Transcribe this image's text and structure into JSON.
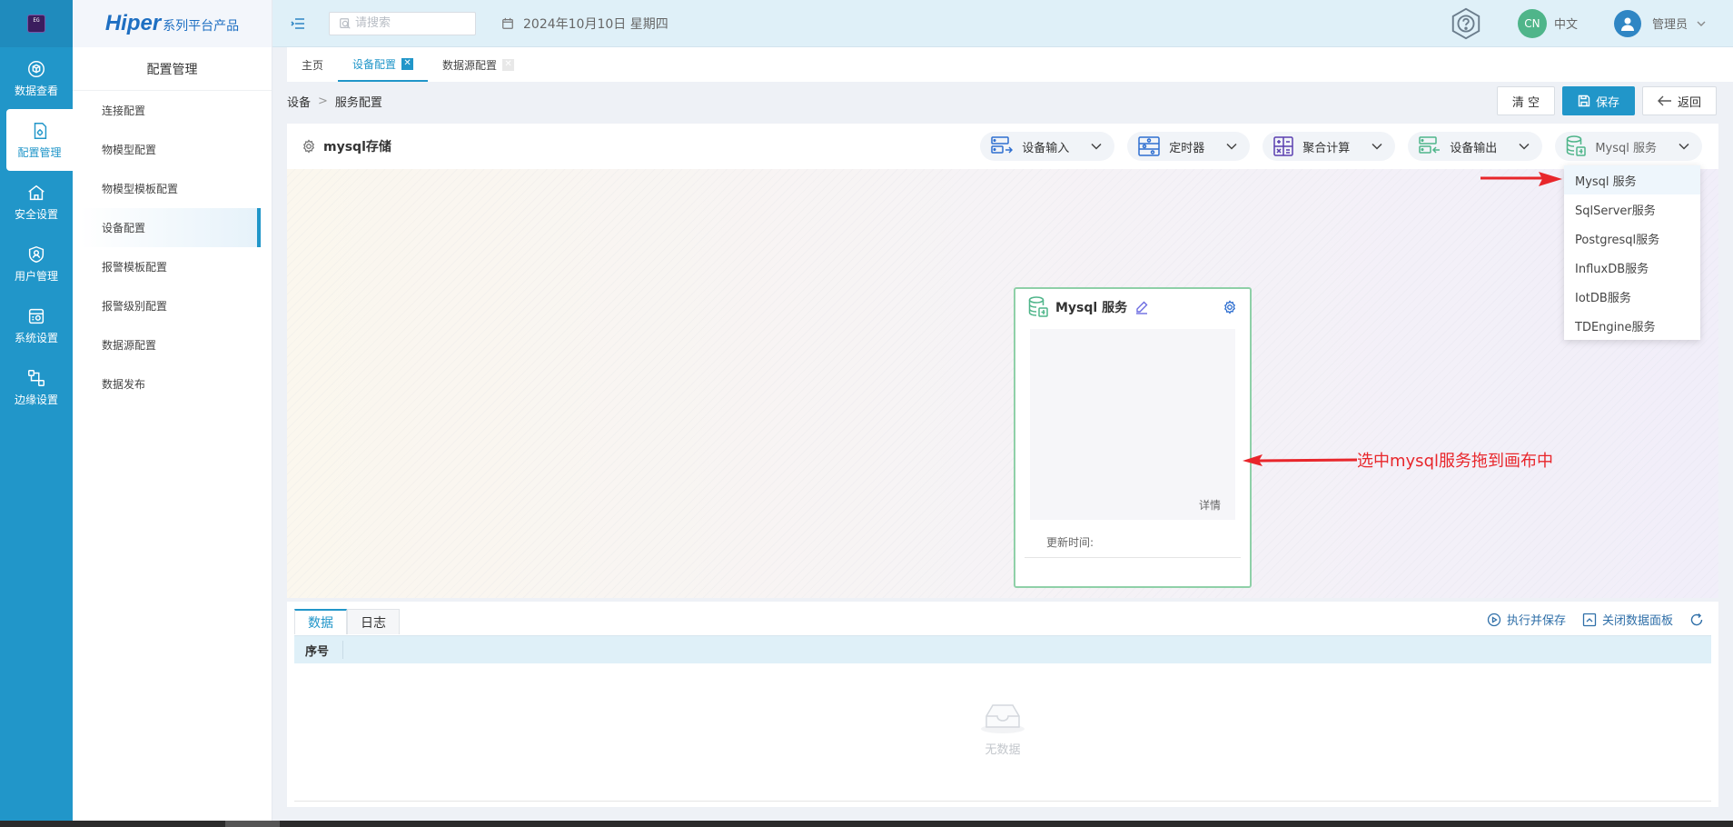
{
  "rail": {
    "items": [
      {
        "label": "数据查看",
        "icon": "cube-icon"
      },
      {
        "label": "配置管理",
        "icon": "config-doc-icon",
        "active": true
      },
      {
        "label": "安全设置",
        "icon": "home-shield-icon"
      },
      {
        "label": "用户管理",
        "icon": "user-shield-icon"
      },
      {
        "label": "系统设置",
        "icon": "system-settings-icon"
      },
      {
        "label": "边缘设置",
        "icon": "edge-network-icon"
      }
    ]
  },
  "brand": {
    "name": "Hiper",
    "suffix": "系列平台产品"
  },
  "sidebar": {
    "title": "配置管理",
    "items": [
      {
        "label": "连接配置"
      },
      {
        "label": "物模型配置"
      },
      {
        "label": "物模型模板配置"
      },
      {
        "label": "设备配置",
        "active": true
      },
      {
        "label": "报警模板配置"
      },
      {
        "label": "报警级别配置"
      },
      {
        "label": "数据源配置"
      },
      {
        "label": "数据发布"
      }
    ]
  },
  "header": {
    "search_placeholder": "请搜索",
    "date": "2024年10月10日 星期四",
    "lang_badge": "CN",
    "lang": "中文",
    "user": "管理员"
  },
  "tabs": [
    {
      "label": "主页"
    },
    {
      "label": "设备配置",
      "active": true
    },
    {
      "label": "数据源配置"
    }
  ],
  "breadcrumb": {
    "root": "设备",
    "sep": ">",
    "current": "服务配置"
  },
  "actions": {
    "clear": "清 空",
    "save": "保存",
    "back": "返回"
  },
  "toolbar": {
    "title": "mysql存储",
    "groups": [
      {
        "label": "设备输入"
      },
      {
        "label": "定时器"
      },
      {
        "label": "聚合计算"
      },
      {
        "label": "设备输出"
      },
      {
        "label": "Mysql 服务"
      }
    ]
  },
  "dropdown": {
    "items": [
      "Mysql 服务",
      "SqlServer服务",
      "Postgresql服务",
      "InfluxDB服务",
      "IotDB服务",
      "TDEngine服务"
    ]
  },
  "node": {
    "title": "Mysql 服务",
    "detail": "详情",
    "update_label": "更新时间:"
  },
  "annotation": "选中mysql服务拖到画布中",
  "panel": {
    "tabs": [
      {
        "label": "数据"
      },
      {
        "label": "日志"
      }
    ],
    "run_save": "执行并保存",
    "close_panel": "关闭数据面板",
    "column": "序号",
    "empty": "无数据"
  },
  "colors": {
    "primary": "#2196c9",
    "annotation": "#e8262b",
    "node_border": "#8fd0a8"
  }
}
